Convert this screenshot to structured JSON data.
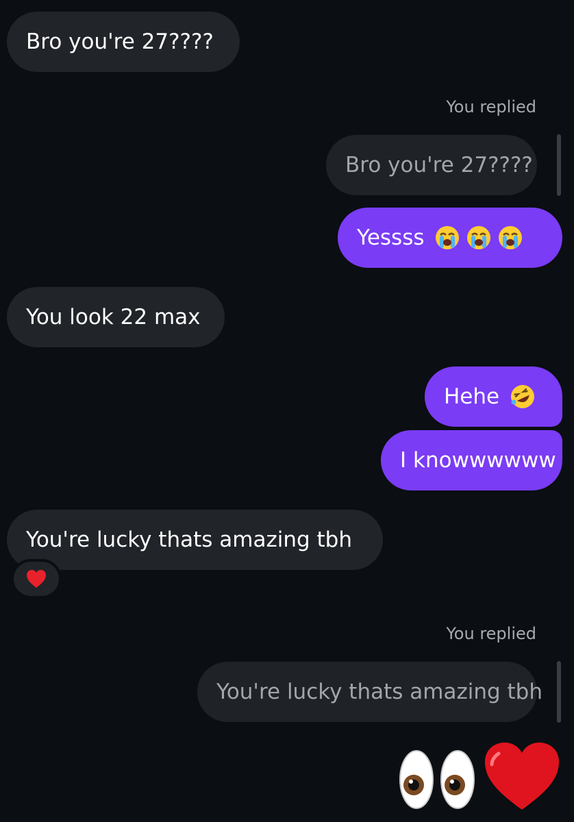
{
  "messages": [
    {
      "id": "m1",
      "direction": "incoming",
      "text": "Bro you're 27????"
    },
    {
      "id": "m2",
      "direction": "outgoing",
      "replied_label": "You replied",
      "quoted_text": "Bro you're 27????",
      "text": "Yessss",
      "emoji": [
        "loudly-crying-face",
        "loudly-crying-face",
        "loudly-crying-face"
      ]
    },
    {
      "id": "m3",
      "direction": "incoming",
      "text": "You look 22 max"
    },
    {
      "id": "m4",
      "direction": "outgoing",
      "text": "Hehe",
      "emoji": [
        "rolling-on-floor-laughing-face"
      ]
    },
    {
      "id": "m5",
      "direction": "outgoing",
      "text": "I knowwwwww"
    },
    {
      "id": "m6",
      "direction": "incoming",
      "text": "You're lucky thats amazing tbh",
      "reaction": "red-heart"
    },
    {
      "id": "m7",
      "direction": "outgoing",
      "replied_label": "You replied",
      "quoted_text": "You're lucky thats amazing tbh",
      "emoji_only": [
        "eyes",
        "red-heart"
      ]
    }
  ],
  "colors": {
    "background": "#0b0e12",
    "incoming_bubble": "#212429",
    "outgoing_bubble": "#7a3cf5",
    "quoted_bubble": "#1f2226",
    "quoted_text": "#a2a5aa",
    "label_text": "#a7aaae"
  }
}
